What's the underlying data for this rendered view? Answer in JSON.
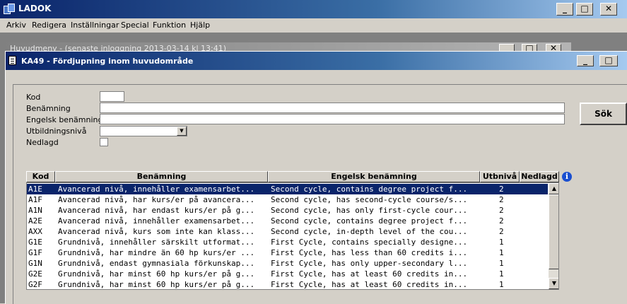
{
  "window": {
    "title": "LADOK"
  },
  "menu": [
    "Arkiv",
    "Redigera",
    "Inställningar",
    "Special",
    "Funktion",
    "Hjälp"
  ],
  "background_window": {
    "title": "Huvudmeny - (senaste inloggning 2013-03-14 kl 13:41)"
  },
  "child_window": {
    "title": "KA49 - Fördjupning inom huvudområde"
  },
  "form": {
    "kod_label": "Kod",
    "kod_value": "",
    "benamning_label": "Benämning",
    "benamning_value": "",
    "engelsk_label": "Engelsk benämning",
    "engelsk_value": "",
    "utbildningsniva_label": "Utbildningsnivå",
    "utbildningsniva_value": "",
    "nedlagd_label": "Nedlagd",
    "search_label": "Sök"
  },
  "table": {
    "columns": [
      "Kod",
      "Benämning",
      "Engelsk benämning",
      "Utbnivå",
      "Nedlagd"
    ],
    "info_icon": "i",
    "rows": [
      {
        "kod": "A1E",
        "benamning": "Avancerad nivå, innehåller examensarbet...",
        "engelsk": "Second cycle, contains degree project f...",
        "niva": "2",
        "nedlagd": ""
      },
      {
        "kod": "A1F",
        "benamning": "Avancerad nivå, har kurs/er på avancera...",
        "engelsk": "Second cycle, has second-cycle course/s...",
        "niva": "2",
        "nedlagd": ""
      },
      {
        "kod": "A1N",
        "benamning": "Avancerad nivå, har endast kurs/er på g...",
        "engelsk": "Second cycle, has only first-cycle cour...",
        "niva": "2",
        "nedlagd": ""
      },
      {
        "kod": "A2E",
        "benamning": "Avancerad nivå, innehåller examensarbet...",
        "engelsk": "Second cycle, contains degree project f...",
        "niva": "2",
        "nedlagd": ""
      },
      {
        "kod": "AXX",
        "benamning": "Avancerad nivå, kurs som inte kan klass...",
        "engelsk": "Second cycle, in-depth level of the cou...",
        "niva": "2",
        "nedlagd": ""
      },
      {
        "kod": "G1E",
        "benamning": "Grundnivå, innehåller särskilt utformat...",
        "engelsk": "First Cycle, contains specially designe...",
        "niva": "1",
        "nedlagd": ""
      },
      {
        "kod": "G1F",
        "benamning": "Grundnivå, har mindre än 60 hp kurs/er ...",
        "engelsk": "First Cycle, has less than 60 credits i...",
        "niva": "1",
        "nedlagd": ""
      },
      {
        "kod": "G1N",
        "benamning": "Grundnivå, endast gymnasiala förkunskap...",
        "engelsk": "First Cycle, has only upper-secondary l...",
        "niva": "1",
        "nedlagd": ""
      },
      {
        "kod": "G2E",
        "benamning": "Grundnivå, har minst 60 hp kurs/er på g...",
        "engelsk": "First Cycle, has at least 60 credits in...",
        "niva": "1",
        "nedlagd": ""
      },
      {
        "kod": "G2F",
        "benamning": "Grundnivå, har minst 60 hp kurs/er på g...",
        "engelsk": "First Cycle, has at least 60 credits in...",
        "niva": "1",
        "nedlagd": ""
      }
    ],
    "selected_row": 0
  }
}
